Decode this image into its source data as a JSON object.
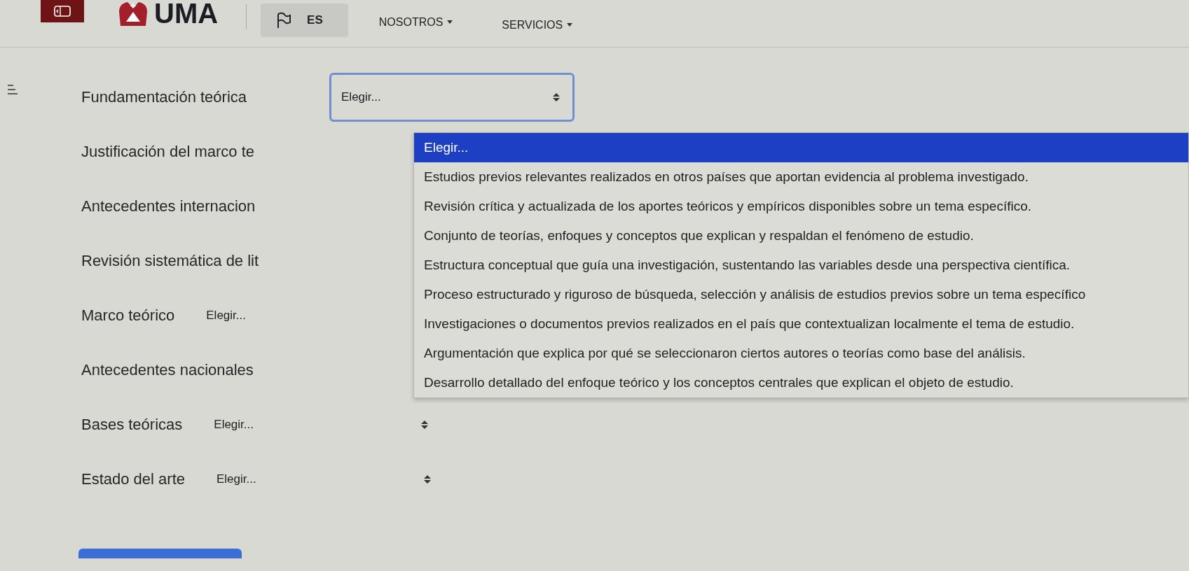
{
  "header": {
    "brand": "UMA",
    "language": "ES",
    "nav": [
      {
        "label": "NOSOTROS"
      },
      {
        "label": "SERVICIOS"
      }
    ]
  },
  "form": {
    "rows": [
      {
        "label": "Fundamentación teórica",
        "select": {
          "value": "Elegir...",
          "focused": true
        }
      },
      {
        "label": "Justificación del marco te"
      },
      {
        "label": "Antecedentes internacion"
      },
      {
        "label": "Revisión sistemática de lit"
      },
      {
        "label": "Marco teórico",
        "select": {
          "value": "Elegir...",
          "focused": false,
          "arrow": false
        }
      },
      {
        "label": "Antecedentes nacionales"
      },
      {
        "label": "Bases teóricas",
        "select": {
          "value": "Elegir...",
          "focused": false,
          "arrow": true
        }
      },
      {
        "label": "Estado del arte",
        "select": {
          "value": "Elegir...",
          "focused": false,
          "arrow": true
        }
      }
    ]
  },
  "dropdown_list": {
    "options": [
      {
        "label": "Elegir...",
        "selected": true
      },
      {
        "label": "Estudios previos relevantes realizados en otros países que aportan evidencia al problema investigado.",
        "selected": false
      },
      {
        "label": "Revisión crítica y actualizada de los aportes teóricos y empíricos disponibles sobre un tema específico.",
        "selected": false
      },
      {
        "label": "Conjunto de teorías, enfoques y conceptos que explican y respaldan el fenómeno de estudio.",
        "selected": false
      },
      {
        "label": "Estructura conceptual que guía una investigación, sustentando las variables desde una perspectiva científica.",
        "selected": false
      },
      {
        "label": "Proceso estructurado y riguroso de búsqueda, selección y análisis de estudios previos sobre un tema específico",
        "selected": false
      },
      {
        "label": "Investigaciones o documentos previos realizados en el país que contextualizan localmente el tema de estudio.",
        "selected": false
      },
      {
        "label": "Argumentación que explica por qué se seleccionaron ciertos autores o teorías como base del análisis.",
        "selected": false
      },
      {
        "label": "Desarrollo detallado del enfoque teórico y los conceptos centrales que explican el objeto de estudio.",
        "selected": false
      }
    ]
  }
}
